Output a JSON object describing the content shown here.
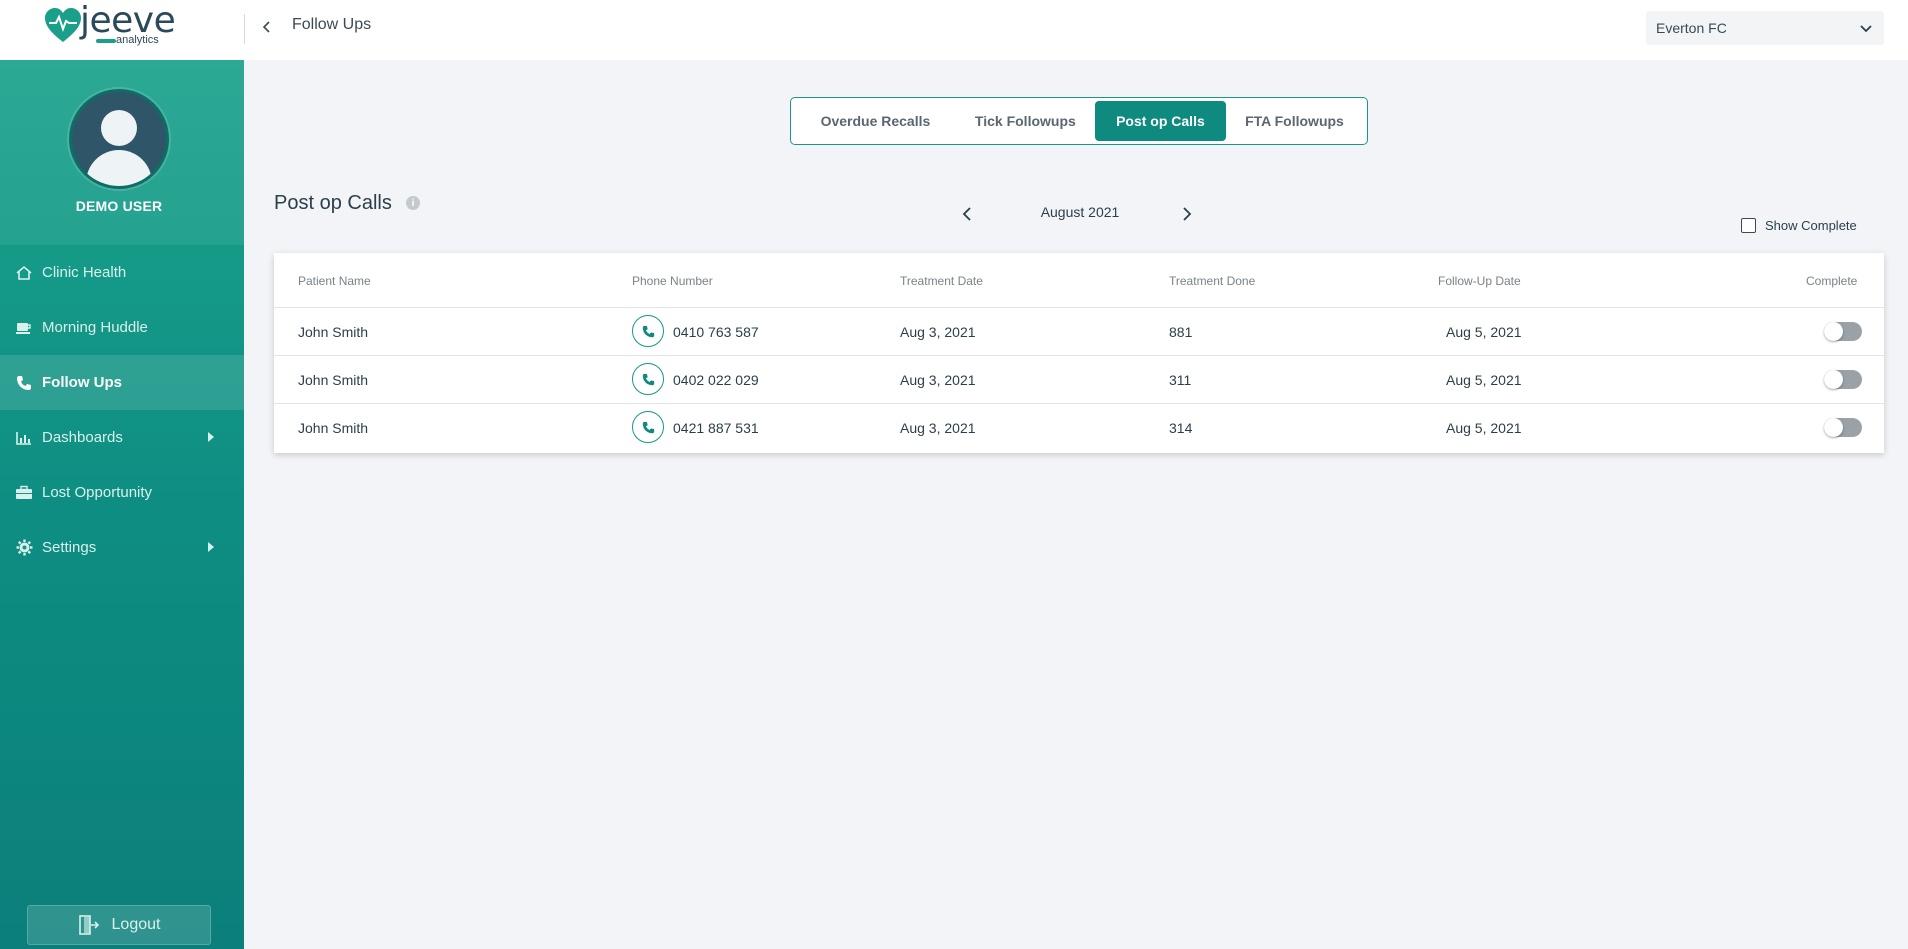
{
  "header": {
    "logo_text": "jeeve",
    "logo_subtext": "analytics",
    "title": "Follow Ups",
    "clinic_selector": {
      "value": "Everton FC"
    }
  },
  "sidebar": {
    "username": "DEMO USER",
    "items": [
      {
        "label": "Clinic Health",
        "icon": "home-icon"
      },
      {
        "label": "Morning Huddle",
        "icon": "coffee-icon"
      },
      {
        "label": "Follow Ups",
        "icon": "phone-icon",
        "active": true
      },
      {
        "label": "Dashboards",
        "icon": "chart-icon",
        "has_submenu": true
      },
      {
        "label": "Lost Opportunity",
        "icon": "briefcase-icon"
      },
      {
        "label": "Settings",
        "icon": "gear-icon",
        "has_submenu": true
      }
    ],
    "logout_label": "Logout"
  },
  "tabs": [
    {
      "label": "Overdue Recalls"
    },
    {
      "label": "Tick Followups"
    },
    {
      "label": "Post op Calls",
      "active": true
    },
    {
      "label": "FTA Followups"
    }
  ],
  "section": {
    "title": "Post op Calls",
    "month": "August 2021",
    "show_complete_label": "Show Complete",
    "show_complete_checked": false
  },
  "table": {
    "columns": [
      "Patient Name",
      "Phone Number",
      "Treatment Date",
      "Treatment Done",
      "Follow-Up Date",
      "Complete"
    ],
    "rows": [
      {
        "patient": "John Smith",
        "phone": "0410 763 587",
        "treatment_date": "Aug 3, 2021",
        "treatment_done": "881",
        "followup_date": "Aug 5, 2021",
        "complete": false
      },
      {
        "patient": "John Smith",
        "phone": "0402 022 029",
        "treatment_date": "Aug 3, 2021",
        "treatment_done": "311",
        "followup_date": "Aug 5, 2021",
        "complete": false
      },
      {
        "patient": "John Smith",
        "phone": "0421 887 531",
        "treatment_date": "Aug 3, 2021",
        "treatment_done": "314",
        "followup_date": "Aug 5, 2021",
        "complete": false
      }
    ]
  },
  "colors": {
    "brand_teal": "#0e8a7f",
    "sidebar_top": "#1ba38d",
    "sidebar_bottom": "#0b7f7b",
    "page_bg": "#f3f4f8"
  }
}
